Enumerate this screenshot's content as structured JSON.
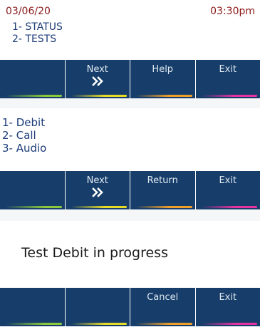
{
  "panel1": {
    "date": "03/06/20",
    "time": "03:30pm",
    "menu": [
      "1- STATUS",
      "2- TESTS"
    ],
    "softkeys": [
      {
        "label": "",
        "arrow": false,
        "accent": "green"
      },
      {
        "label": "Next",
        "arrow": true,
        "accent": "yellow"
      },
      {
        "label": "Help",
        "arrow": false,
        "accent": "orange"
      },
      {
        "label": "Exit",
        "arrow": false,
        "accent": "pink"
      }
    ]
  },
  "panel2": {
    "menu": [
      "1- Debit",
      "2- Call",
      "3- Audio"
    ],
    "softkeys": [
      {
        "label": "",
        "arrow": false,
        "accent": "green"
      },
      {
        "label": "Next",
        "arrow": true,
        "accent": "yellow"
      },
      {
        "label": "Return",
        "arrow": false,
        "accent": "orange"
      },
      {
        "label": "Exit",
        "arrow": false,
        "accent": "pink"
      }
    ]
  },
  "panel3": {
    "message": "Test Debit in progress",
    "softkeys": [
      {
        "label": "",
        "arrow": false,
        "accent": "green"
      },
      {
        "label": "",
        "arrow": false,
        "accent": "yellow"
      },
      {
        "label": "Cancel",
        "arrow": false,
        "accent": "orange"
      },
      {
        "label": "Exit",
        "arrow": false,
        "accent": "pink"
      }
    ]
  },
  "colors": {
    "softkey_bg": "#173e6a",
    "date_time": "#8b1a1a",
    "menu_text": "#1d3c78",
    "accent_green": "#8cc83c",
    "accent_yellow": "#e6dc28",
    "accent_orange": "#f0a028",
    "accent_pink": "#e632a0"
  }
}
